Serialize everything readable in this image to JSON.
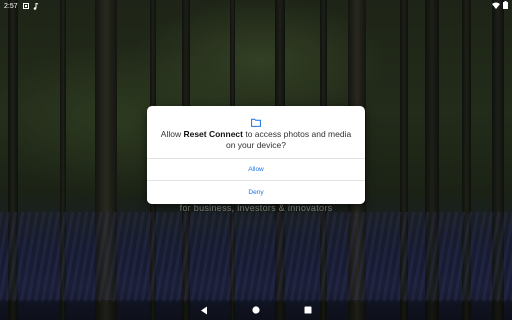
{
  "status_bar": {
    "time": "2:57",
    "icons": [
      "sim-card-icon",
      "music-note-icon",
      "wifi-icon",
      "battery-icon"
    ]
  },
  "background": {
    "tagline": "for business, investors & innovators"
  },
  "dialog": {
    "icon": "folder-icon",
    "message_prefix": "Allow ",
    "app_name": "Reset Connect",
    "message_suffix": " to access photos and media on your device?",
    "allow_label": "Allow",
    "deny_label": "Deny",
    "accent_color": "#1a73e8"
  },
  "nav_bar": {
    "buttons": [
      "back-icon",
      "home-icon",
      "recents-icon"
    ]
  }
}
